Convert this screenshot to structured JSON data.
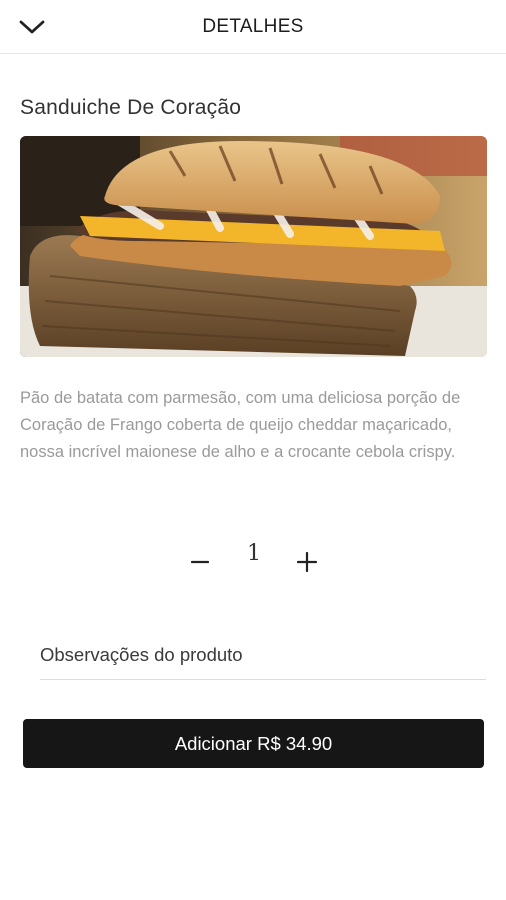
{
  "header": {
    "title": "DETALHES",
    "back_icon": "chevron-down-icon"
  },
  "product": {
    "name": "Sanduiche De Coração",
    "description": "Pão de batata com parmesão, com uma deliciosa porção de Coração de Frango coberta de queijo cheddar maçaricado, nossa incrível maionese de alho e a crocante cebola crispy.",
    "image_subject": "sandwich-photo"
  },
  "quantity": {
    "value": "1",
    "minus_icon": "minus-icon",
    "plus_icon": "plus-icon"
  },
  "notes": {
    "placeholder": "Observações do produto",
    "value": ""
  },
  "add_button": {
    "label": "Adicionar R$ 34.90"
  },
  "colors": {
    "button_bg": "#161616",
    "description_text": "#9a9a9a",
    "divider": "#e6e6e6"
  }
}
